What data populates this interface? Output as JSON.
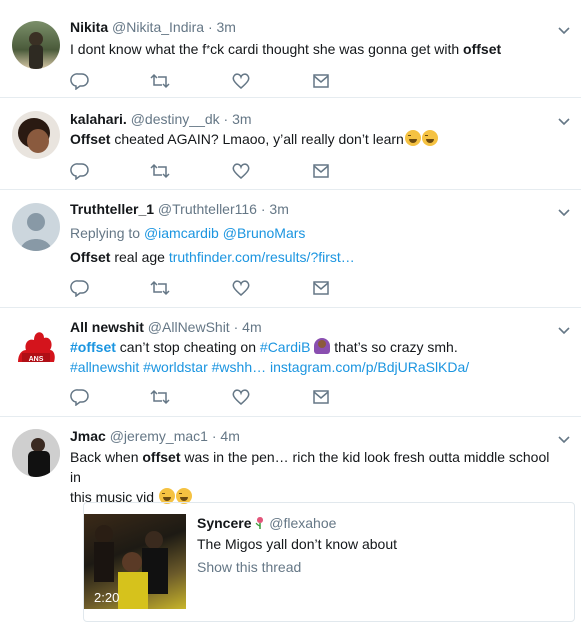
{
  "tweets": [
    {
      "name": "Nikita",
      "handle": "@Nikita_Indira",
      "sep": "·",
      "time": "3m",
      "text_parts": [
        "I dont know what the f",
        "*",
        "ck cardi thought she was gonna get with "
      ],
      "bold": "offset"
    },
    {
      "name": "kalahari.",
      "handle": "@destiny__dk",
      "sep": "·",
      "time": "3m",
      "bold": "Offset",
      "text": " cheated AGAIN? Lmaoo, y’all really don’t learn"
    },
    {
      "name": "Truthteller_1",
      "handle": "@Truthteller116",
      "sep": "·",
      "time": "3m",
      "replying_label": "Replying to",
      "replying_to": [
        "@iamcardib",
        "@BrunoMars"
      ],
      "bold": "Offset",
      "text": " real age ",
      "link": "truthfinder.com/results/?first…"
    },
    {
      "name": "All newshit",
      "handle": "@AllNewShit",
      "sep": "·",
      "time": "4m",
      "hashtag1": "#offset",
      "text1": " can’t stop cheating on ",
      "hashtag2": "#CardiB",
      "text2": " that’s so crazy smh.",
      "line2": [
        "#allnewshit",
        "#worldstar",
        "#wshh…",
        "instagram.com/p/BdjURaSlKDa/"
      ],
      "avatar_label": "ANS"
    },
    {
      "name": "Jmac",
      "handle": "@jeremy_mac1",
      "sep": "·",
      "time": "4m",
      "text_before": "Back when ",
      "bold": "offset",
      "text_after": " was in the pen… rich the kid look fresh outta middle school in",
      "line2": "this music vid"
    }
  ],
  "quoted": {
    "name": "Syncere",
    "handle": "@flexahoe",
    "text": "The Migos yall don’t know about",
    "more": "Show this thread",
    "duration": "2:20"
  },
  "icons": [
    "reply-icon",
    "retweet-icon",
    "like-icon",
    "dm-icon",
    "chevron-down-icon"
  ],
  "colors": {
    "link": "#1b95e0",
    "muted": "#657786",
    "divider": "#e6ecf0"
  }
}
